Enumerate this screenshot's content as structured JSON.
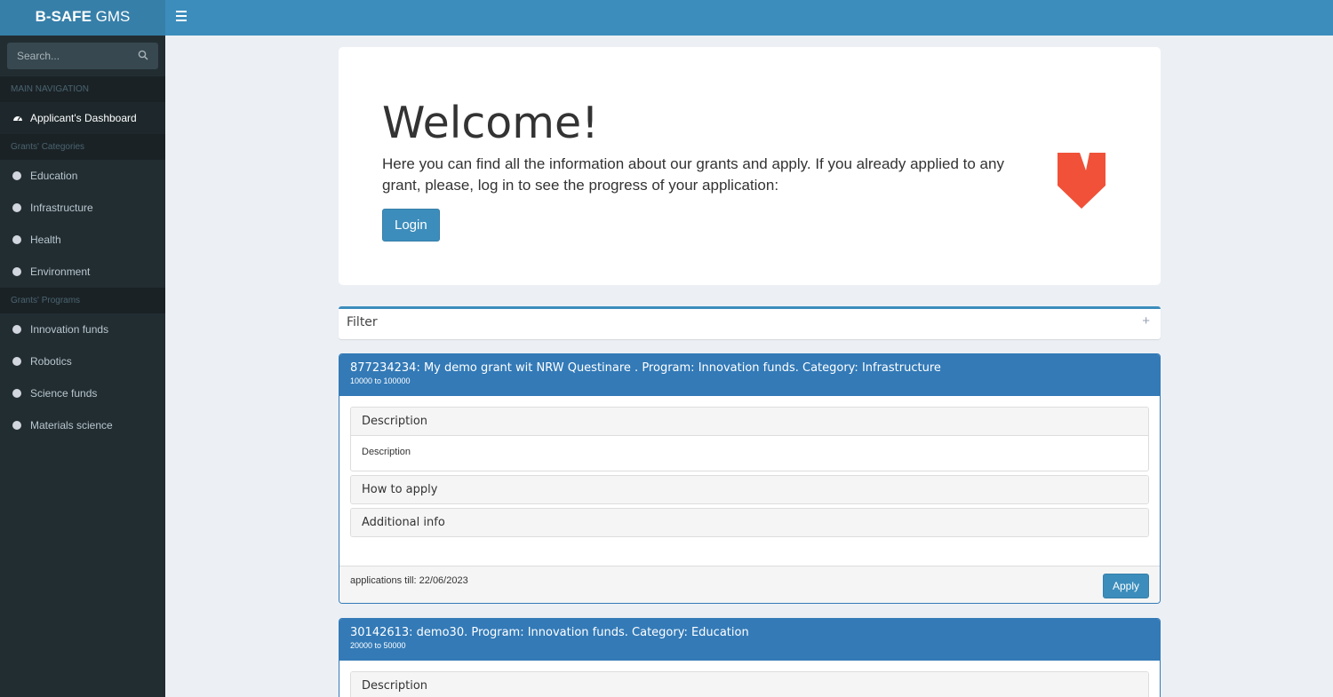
{
  "app": {
    "brand_bold": "B-SAFE",
    "brand_light": "GMS"
  },
  "sidebar": {
    "search_placeholder": "Search...",
    "main_nav_header": "MAIN NAVIGATION",
    "dashboard_label": "Applicant's Dashboard",
    "categories_header": "Grants' Categories",
    "categories": [
      "Education",
      "Infrastructure",
      "Health",
      "Environment"
    ],
    "programs_header": "Grants' Programs",
    "programs": [
      "Innovation funds",
      "Robotics",
      "Science funds",
      "Materials science"
    ]
  },
  "welcome": {
    "title": "Welcome!",
    "text": "Here you can find all the information about our grants and apply. If you already applied to any grant, please, log in to see the progress of your application:",
    "login_label": "Login",
    "logo_color": "#f05138"
  },
  "filter": {
    "title": "Filter",
    "toggle": "+"
  },
  "grants": [
    {
      "title": "877234234: My demo grant wit NRW Questinare . Program: Innovation funds. Category: Infrastructure",
      "range": "10000 to 100000",
      "description_header": "Description",
      "description_body": "Description",
      "how_to_apply_header": "How to apply",
      "additional_info_header": "Additional info",
      "deadline": "applications till: 22/06/2023",
      "apply_label": "Apply"
    },
    {
      "title": "30142613: demo30. Program: Innovation funds. Category: Education",
      "range": "20000 to 50000",
      "description_header": "Description"
    }
  ],
  "colors": {
    "accent": "#3c8dbc",
    "panel_header": "#337ab7",
    "sidebar_bg": "#222d32"
  }
}
